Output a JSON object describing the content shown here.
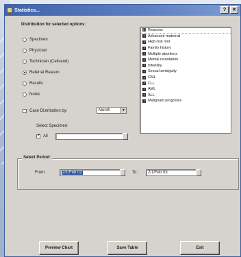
{
  "window": {
    "title": "Statistics..."
  },
  "distribution": {
    "heading": "Distribution for selected options:",
    "options": [
      {
        "label": "Specimen",
        "selected": false
      },
      {
        "label": "Physician",
        "selected": false
      },
      {
        "label": "Technician (Cellsend)",
        "selected": false
      },
      {
        "label": "Referral Reason",
        "selected": true
      },
      {
        "label": "Results",
        "selected": false
      },
      {
        "label": "Notes",
        "selected": false
      }
    ],
    "case_distribution_label": "Case Distribution by:",
    "case_distribution_value": "Month",
    "select_specimen_label": "Select Specimen:",
    "all_label": "All"
  },
  "reasons": {
    "header": "Reasons",
    "items": [
      "Advanced maternal",
      "High-risk mot",
      "Family history",
      "Multiple abortions",
      "Mental retardation",
      "Infertility",
      "Sexual ambiguity",
      "CML",
      "CLL",
      "AML",
      "ALL",
      "Malignant prognosis"
    ]
  },
  "period": {
    "heading": "Select Period:",
    "from_label": "From:",
    "from_value": "2/1/Feb 02",
    "to_label": "To:",
    "to_value": "2/1/Feb 03"
  },
  "buttons": {
    "preview": "Preview Chart",
    "save": "Save Table",
    "exit": "Exit"
  }
}
